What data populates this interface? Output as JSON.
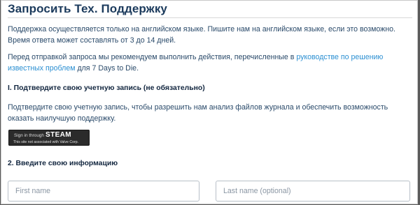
{
  "page": {
    "title": "Запросить Тех. Поддержку",
    "intro": "Поддержка осуществляется только на английском языке. Пишите нам на английском языке, если это возможно. Время ответа может составлять от 3 до 14 дней.",
    "recommend_before": "Перед отправкой запроса мы рекомендуем выполнить действия, перечисленные в ",
    "recommend_link": "руководстве по решению известных проблем",
    "recommend_after": " для 7 Days to Die."
  },
  "step1": {
    "heading": "I.  Подтвердите свою учетную запись (не обязательно)",
    "description": "Подтвердите свою учетную запись, чтобы разрешить нам анализ файлов журнала и обеспечить возможность оказать наилучшую поддержку.",
    "steam_button": {
      "sign_in_text": "Sign in through",
      "brand": "STEAM",
      "disclaimer": "This site not associated with Valve Corp."
    }
  },
  "step2": {
    "heading": "2.  Введите свою информацию",
    "first_name_placeholder": "First name",
    "last_name_placeholder": "Last name (optional)"
  },
  "colors": {
    "title": "#1b3a5c",
    "link": "#2b8fd2",
    "steam_button_bg": "#2b2b2b"
  }
}
